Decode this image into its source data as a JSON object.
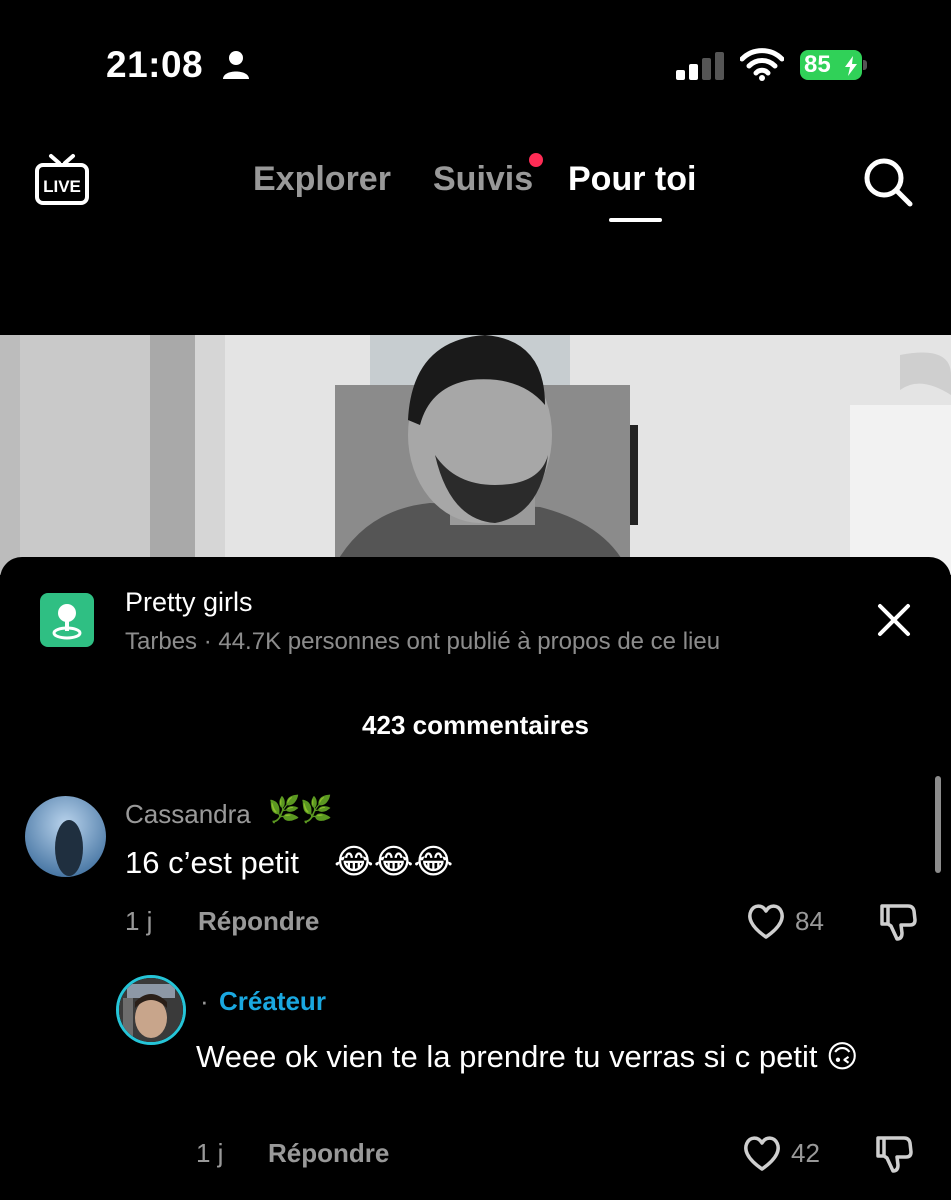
{
  "status_bar": {
    "time": "21:08",
    "battery_level": "85",
    "battery_color": "#30d158"
  },
  "top_nav": {
    "live_label": "LIVE",
    "tabs": [
      {
        "label": "Explorer",
        "active": false
      },
      {
        "label": "Suivis",
        "active": false,
        "has_notification_dot": true
      },
      {
        "label": "Pour toi",
        "active": true
      }
    ],
    "search_icon": "search-icon",
    "notification_dot_color": "#fe2c55"
  },
  "location": {
    "title": "Pretty girls",
    "subtitle": "Tarbes · 44.7K personnes ont publié à propos de ce lieu",
    "icon": "map-pin-icon",
    "icon_color": "#2fbf83"
  },
  "comments": {
    "count_label": "423 commentaires",
    "items": [
      {
        "username": "Cassandra",
        "username_emoji": "🌿🌿",
        "text": "16 c’est petit",
        "text_emoji": "😂😂😂",
        "time": "1 j",
        "reply_label": "Répondre",
        "likes": "84"
      },
      {
        "creator_badge": "Créateur",
        "badge_prefix": "·",
        "badge_color": "#1aa8e0",
        "text": "Weee ok vien te la prendre tu verras si c petit 🙃",
        "time": "1 j",
        "reply_label": "Répondre",
        "likes": "42"
      }
    ]
  }
}
